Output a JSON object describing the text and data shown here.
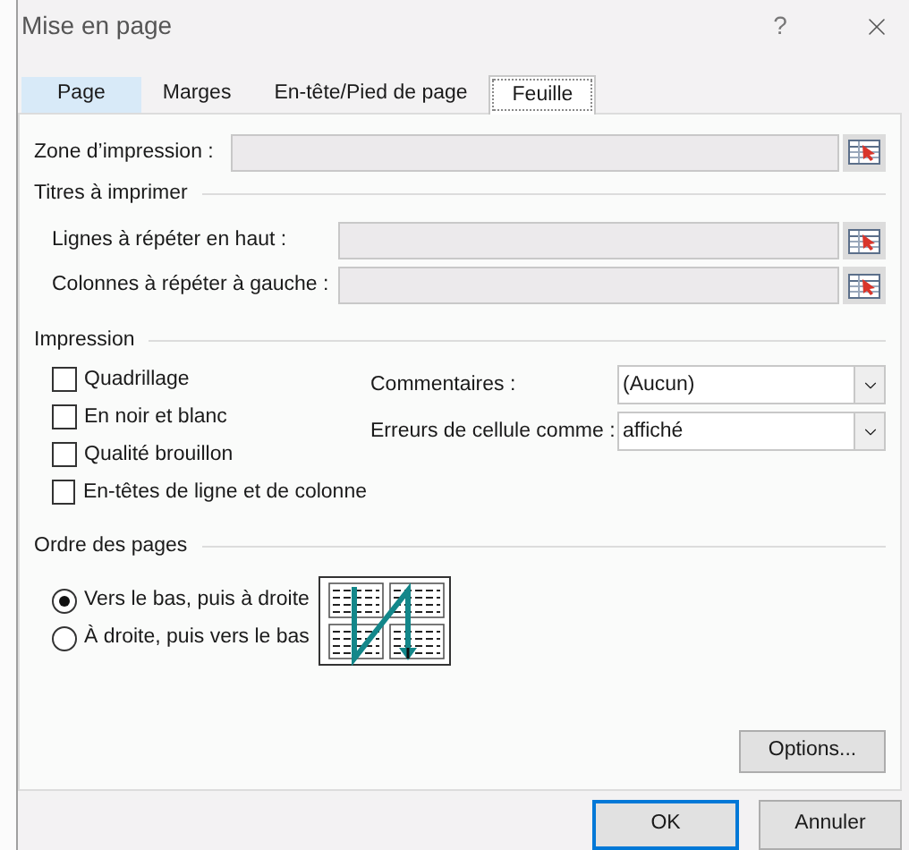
{
  "window": {
    "title": "Mise en page",
    "help": "?"
  },
  "tabs": [
    {
      "label": "Page",
      "selected": false,
      "hovered": true
    },
    {
      "label": "Marges",
      "selected": false,
      "hovered": false
    },
    {
      "label": "En-tête/Pied de page",
      "selected": false,
      "hovered": false
    },
    {
      "label": "Feuille",
      "selected": true,
      "hovered": false
    }
  ],
  "print_area": {
    "label": "Zone d’impression :"
  },
  "print_titles": {
    "heading": "Titres à imprimer",
    "fields": [
      {
        "label": "Lignes à répéter en haut :"
      },
      {
        "label": "Colonnes à répéter à gauche :"
      }
    ]
  },
  "printing": {
    "heading": "Impression",
    "checkboxes": [
      {
        "label": "Quadrillage",
        "checked": false
      },
      {
        "label": "En noir et blanc",
        "checked": false
      },
      {
        "label": "Qualité brouillon",
        "checked": false
      },
      {
        "label": "En-têtes de ligne et de colonne",
        "checked": false
      }
    ],
    "dropdowns": [
      {
        "label": "Commentaires :",
        "value": "(Aucun)"
      },
      {
        "label": "Erreurs de cellule comme :",
        "value": "affiché"
      }
    ]
  },
  "page_order": {
    "heading": "Ordre des pages",
    "options": [
      {
        "label": "Vers le bas, puis à droite",
        "selected": true
      },
      {
        "label": "À droite, puis vers le bas",
        "selected": false
      }
    ]
  },
  "buttons": {
    "options": "Options...",
    "ok": "OK",
    "cancel": "Annuler"
  }
}
